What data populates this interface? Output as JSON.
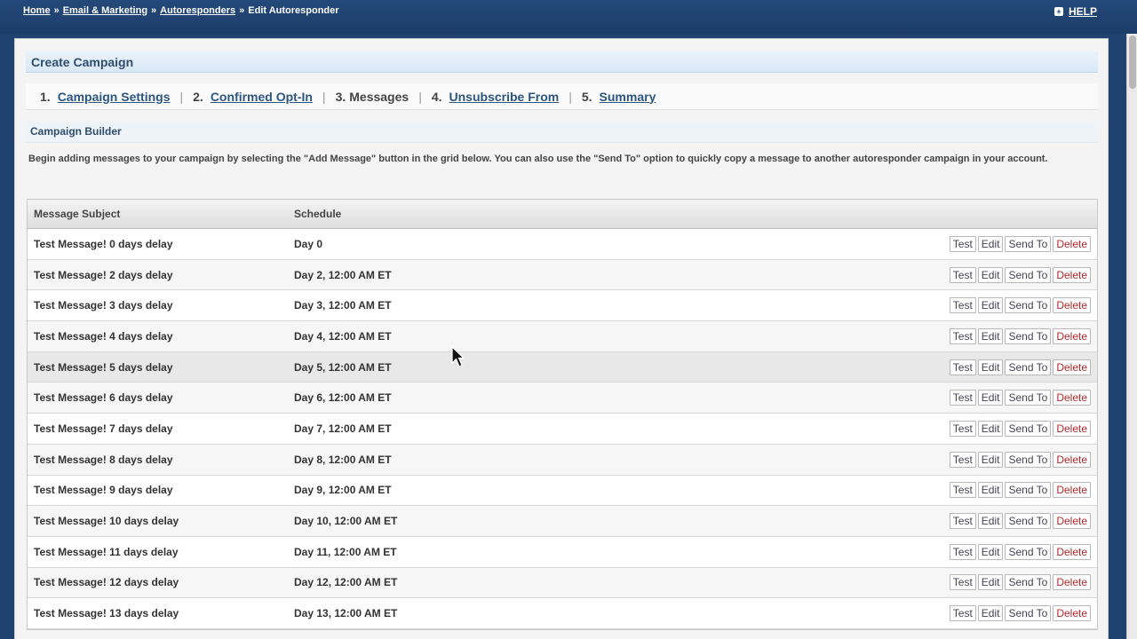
{
  "breadcrumb": {
    "items": [
      "Home",
      "Email & Marketing",
      "Autoresponders"
    ],
    "separator": "»",
    "current": "Edit Autoresponder"
  },
  "help": {
    "label": "HELP",
    "icon": "plus-icon"
  },
  "page": {
    "title": "Create Campaign"
  },
  "steps": [
    {
      "num": "1.",
      "label": "Campaign Settings"
    },
    {
      "num": "2.",
      "label": "Confirmed Opt-In"
    },
    {
      "num": "3.",
      "label": "Messages"
    },
    {
      "num": "4.",
      "label": "Unsubscribe From"
    },
    {
      "num": "5.",
      "label": "Summary"
    }
  ],
  "builder": {
    "title": "Campaign Builder",
    "intro": "Begin adding messages to your campaign by selecting the \"Add Message\" button in the grid below. You can also use the \"Send To\" option to quickly copy a message to another autoresponder campaign in your account."
  },
  "grid": {
    "headers": {
      "subject": "Message Subject",
      "schedule": "Schedule"
    },
    "actions": {
      "test": "Test",
      "edit": "Edit",
      "send_to": "Send To",
      "delete": "Delete"
    },
    "rows": [
      {
        "subject": "Test Message! 0 days delay",
        "schedule": "Day 0"
      },
      {
        "subject": "Test Message! 2 days delay",
        "schedule": "Day 2, 12:00 AM ET"
      },
      {
        "subject": "Test Message! 3 days delay",
        "schedule": "Day 3, 12:00 AM ET"
      },
      {
        "subject": "Test Message! 4 days delay",
        "schedule": "Day 4, 12:00 AM ET"
      },
      {
        "subject": "Test Message! 5 days delay",
        "schedule": "Day 5, 12:00 AM ET"
      },
      {
        "subject": "Test Message! 6 days delay",
        "schedule": "Day 6, 12:00 AM ET"
      },
      {
        "subject": "Test Message! 7 days delay",
        "schedule": "Day 7, 12:00 AM ET"
      },
      {
        "subject": "Test Message! 8 days delay",
        "schedule": "Day 8, 12:00 AM ET"
      },
      {
        "subject": "Test Message! 9 days delay",
        "schedule": "Day 9, 12:00 AM ET"
      },
      {
        "subject": "Test Message! 10 days delay",
        "schedule": "Day 10, 12:00 AM ET"
      },
      {
        "subject": "Test Message! 11 days delay",
        "schedule": "Day 11, 12:00 AM ET"
      },
      {
        "subject": "Test Message! 12 days delay",
        "schedule": "Day 12, 12:00 AM ET"
      },
      {
        "subject": "Test Message! 13 days delay",
        "schedule": "Day 13, 12:00 AM ET"
      }
    ]
  },
  "colors": {
    "header_bar": "#1f4270",
    "link": "#2d567f",
    "delete": "#b52828"
  }
}
